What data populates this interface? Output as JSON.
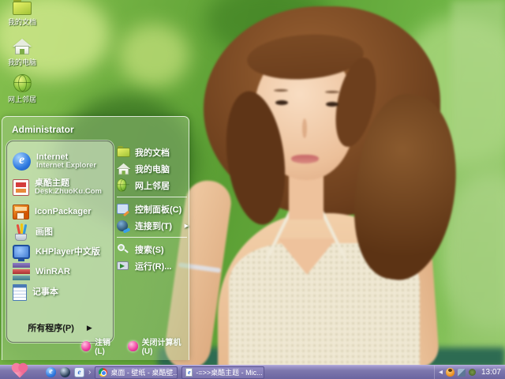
{
  "desktop": {
    "icons": [
      {
        "label": "我的文档",
        "icon": "my-documents-folder-icon"
      },
      {
        "label": "我的电脑",
        "icon": "my-computer-icon"
      },
      {
        "label": "网上邻居",
        "icon": "network-places-icon"
      }
    ]
  },
  "start_menu": {
    "user": "Administrator",
    "left_items": [
      {
        "label": "Internet",
        "sublabel": "Internet Explorer",
        "icon": "internet-explorer-icon"
      },
      {
        "label": "桌酷主题",
        "sublabel": "Desk.ZhuoKu.Com",
        "icon": "zhuoku-theme-icon"
      },
      {
        "label": "IconPackager",
        "icon": "iconpackager-icon"
      },
      {
        "label": "画图",
        "icon": "paint-icon"
      },
      {
        "label": "KHPlayer中文版",
        "icon": "khplayer-icon"
      },
      {
        "label": "WinRAR",
        "icon": "winrar-icon"
      },
      {
        "label": "记事本",
        "icon": "notepad-icon"
      }
    ],
    "all_programs": {
      "label": "所有程序(P)",
      "arrow": "▶"
    },
    "right_items_top": [
      {
        "label": "我的文档",
        "icon": "my-documents-folder-icon"
      },
      {
        "label": "我的电脑",
        "icon": "my-computer-icon"
      },
      {
        "label": "网上邻居",
        "icon": "network-places-icon"
      }
    ],
    "right_items_bottom": [
      {
        "label": "控制面板(C)",
        "icon": "control-panel-icon"
      },
      {
        "label": "连接到(T)",
        "icon": "connect-to-icon",
        "arrow": "▶"
      },
      {
        "label": "搜索(S)",
        "icon": "search-icon"
      },
      {
        "label": "运行(R)...",
        "icon": "run-icon"
      }
    ],
    "footer": {
      "logoff": "注销(L)",
      "shutdown": "关闭计算机(U)"
    }
  },
  "taskbar": {
    "quick_launch_icons": [
      "internet-explorer-icon",
      "world-globe-icon",
      "browser-window-icon"
    ],
    "overflow_chevron": "›",
    "tasks": [
      {
        "label": "桌面 - 壁纸 - 桌酷壁...",
        "icon": "chrome-icon"
      },
      {
        "label": "-=>>桌酷主题 - Mic...",
        "icon": "ie-document-icon"
      }
    ],
    "tray": {
      "chevron": "◂",
      "icons": [
        "qq-icon",
        "security-icon",
        "update-icon"
      ],
      "clock": "13:07"
    }
  },
  "colors": {
    "taskbar_purple": "#7e78ae",
    "start_heart_pink": "#ef6a96",
    "menu_glass_green": "rgba(168,202,142,0.42)",
    "background_green": "#6fb545"
  }
}
